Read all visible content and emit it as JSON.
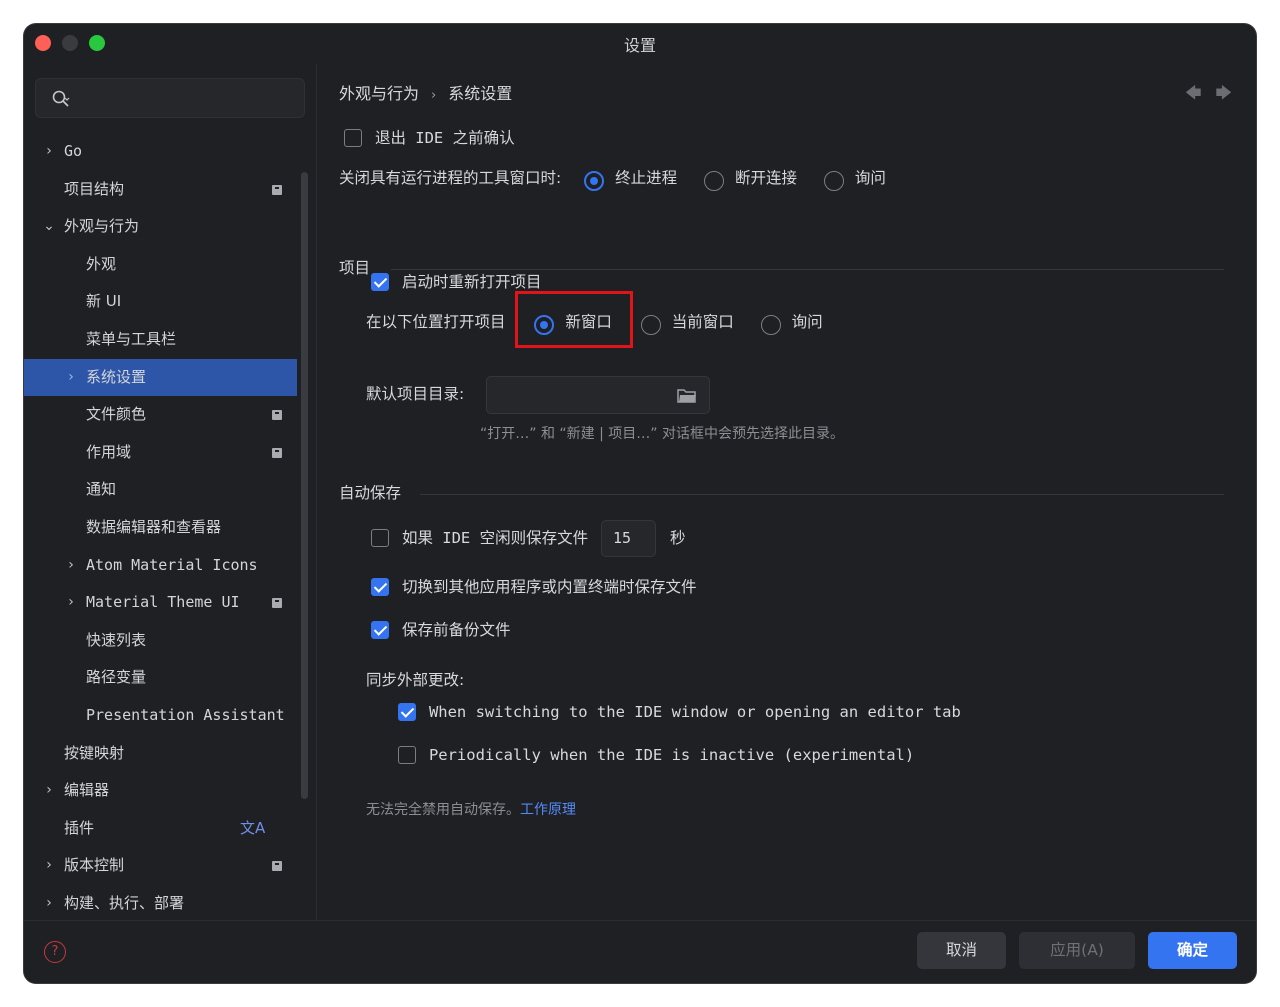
{
  "window": {
    "title": "设置"
  },
  "sidebar": {
    "search_placeholder": "",
    "items": [
      {
        "label": "Go",
        "expand": "›",
        "badge": false
      },
      {
        "label": "项目结构",
        "expand": "",
        "badge": true
      },
      {
        "label": "外观与行为",
        "expand": "⌄",
        "badge": false
      },
      {
        "label": "外观",
        "expand": "",
        "badge": false
      },
      {
        "label": "新 UI",
        "expand": "",
        "badge": false
      },
      {
        "label": "菜单与工具栏",
        "expand": "",
        "badge": false
      },
      {
        "label": "系统设置",
        "expand": "›",
        "badge": false,
        "selected": true
      },
      {
        "label": "文件颜色",
        "expand": "",
        "badge": true
      },
      {
        "label": "作用域",
        "expand": "",
        "badge": true
      },
      {
        "label": "通知",
        "expand": "",
        "badge": false
      },
      {
        "label": "数据编辑器和查看器",
        "expand": "",
        "badge": false
      },
      {
        "label": "Atom Material Icons",
        "expand": "›",
        "badge": false
      },
      {
        "label": "Material Theme UI",
        "expand": "›",
        "badge": true
      },
      {
        "label": "快速列表",
        "expand": "",
        "badge": false
      },
      {
        "label": "路径变量",
        "expand": "",
        "badge": false
      },
      {
        "label": "Presentation Assistant",
        "expand": "",
        "badge": false
      },
      {
        "label": "按键映射",
        "expand": "",
        "badge": false
      },
      {
        "label": "编辑器",
        "expand": "›",
        "badge": false
      },
      {
        "label": "插件",
        "expand": "",
        "badge": false,
        "translate_icon": "文A"
      },
      {
        "label": "版本控制",
        "expand": "›",
        "badge": true
      },
      {
        "label": "构建、执行、部署",
        "expand": "›",
        "badge": false
      }
    ]
  },
  "breadcrumb": {
    "parent": "外观与行为",
    "sep": "›",
    "current": "系统设置"
  },
  "nav": {
    "back": "🡄",
    "forward": "🡆"
  },
  "general": {
    "confirm_exit_label": "退出 IDE 之前确认",
    "confirm_exit_checked": false,
    "close_tool_label": "关闭具有运行进程的工具窗口时:",
    "close_tool_options": [
      "终止进程",
      "断开连接",
      "询问"
    ],
    "close_tool_selected": 0
  },
  "project": {
    "section_title": "项目",
    "reopen_label": "启动时重新打开项目",
    "reopen_checked": true,
    "open_location_label": "在以下位置打开项目",
    "open_location_options": [
      "新窗口",
      "当前窗口",
      "询问"
    ],
    "open_location_selected": 0,
    "default_dir_label": "默认项目目录:",
    "default_dir_value": "",
    "default_dir_hint": "“打开…” 和 “新建 | 项目…” 对话框中会预先选择此目录。"
  },
  "autosave": {
    "section_title": "自动保存",
    "idle_save_label": "如果 IDE 空闲则保存文件",
    "idle_save_checked": false,
    "idle_seconds": "15",
    "idle_unit": "秒",
    "switch_save_label": "切换到其他应用程序或内置终端时保存文件",
    "switch_save_checked": true,
    "backup_label": "保存前备份文件",
    "backup_checked": true,
    "sync_label": "同步外部更改:",
    "sync_option1": "When switching to the IDE window or opening an editor tab",
    "sync_option1_checked": true,
    "sync_option2": "Periodically when the IDE is inactive (experimental)",
    "sync_option2_checked": false,
    "note_text": "无法完全禁用自动保存。",
    "note_link": "工作原理"
  },
  "footer": {
    "help_icon": "?",
    "cancel": "取消",
    "apply": "应用(A)",
    "ok": "确定"
  },
  "colors": {
    "accent": "#3574f0",
    "selection": "#2e56a8",
    "highlight_box": "#e0141a",
    "background": "#1f2024"
  }
}
